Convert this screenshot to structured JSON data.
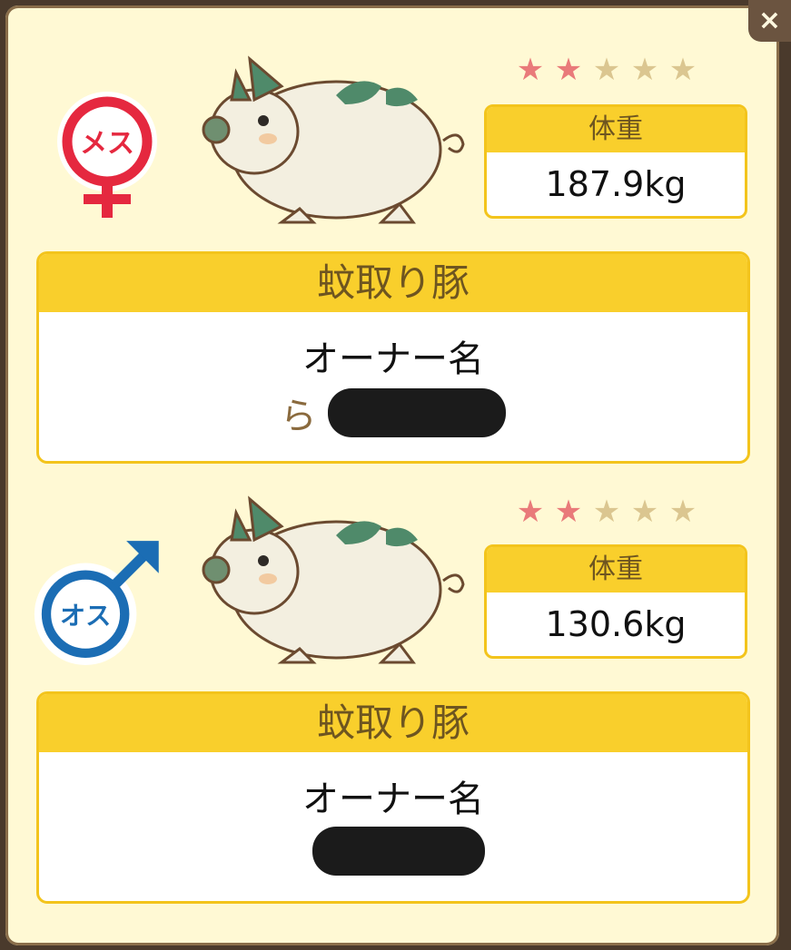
{
  "close_icon": "×",
  "colors": {
    "panel_bg": "#fff9d4",
    "header_yellow": "#f9cf2c",
    "header_text": "#6e5520",
    "star_filled": "#e97a7a",
    "star_empty": "#dbc690",
    "female_red": "#e5283f",
    "male_blue": "#1b6db4"
  },
  "pigs": [
    {
      "gender_label": "メス",
      "gender_icon": "female-symbol-icon",
      "rating": 2,
      "rating_max": 5,
      "star_glyph": "★",
      "weight_label": "体重",
      "weight_value": "187.9kg",
      "breed": "蚊取り豚",
      "owner_label": "オーナー名",
      "owner_name_visible": "ら"
    },
    {
      "gender_label": "オス",
      "gender_icon": "male-symbol-icon",
      "rating": 2,
      "rating_max": 5,
      "star_glyph": "★",
      "weight_label": "体重",
      "weight_value": "130.6kg",
      "breed": "蚊取り豚",
      "owner_label": "オーナー名",
      "owner_name_visible": ""
    }
  ]
}
